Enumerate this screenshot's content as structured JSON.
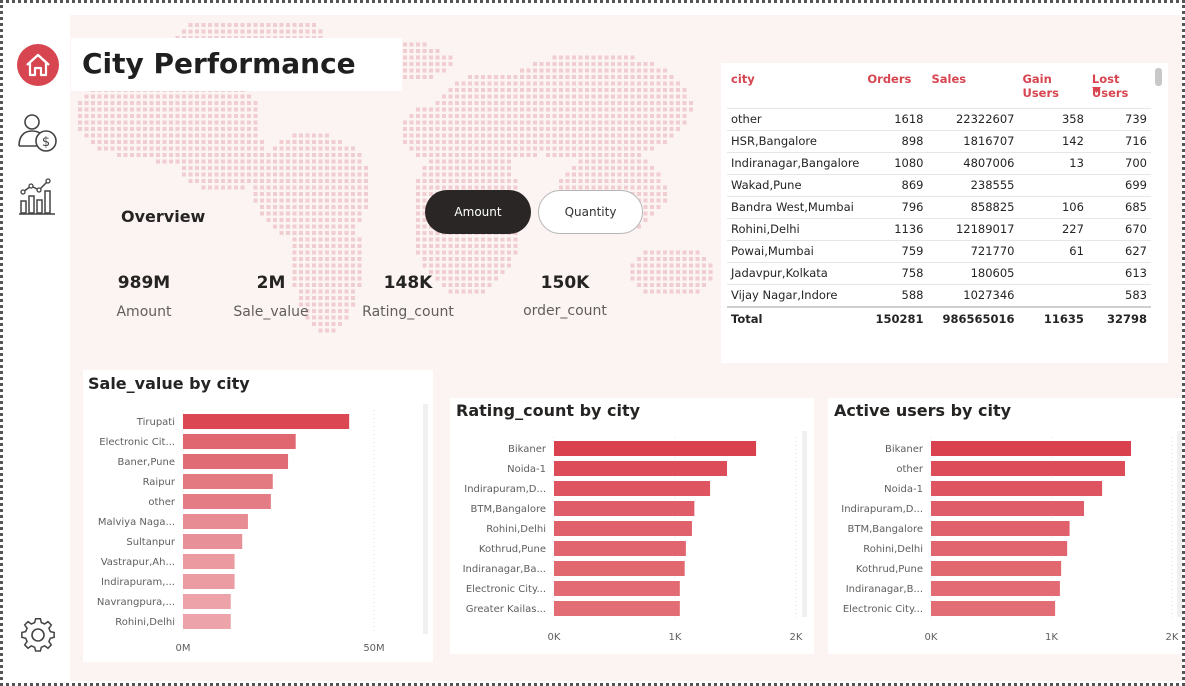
{
  "title": "City Performance",
  "overview_label": "Overview",
  "toggle": {
    "amount": "Amount",
    "quantity": "Quantity"
  },
  "kpis": [
    {
      "value": "989M",
      "label": "Amount"
    },
    {
      "value": "2M",
      "label": "Sale_value"
    },
    {
      "value": "148K",
      "label": "Rating_count"
    },
    {
      "value": "150K",
      "label": "order_count"
    }
  ],
  "table": {
    "headers": [
      "city",
      "Orders",
      "Sales",
      "Gain Users",
      "Lost Users"
    ],
    "rows": [
      [
        "other",
        "1618",
        "22322607",
        "358",
        "739"
      ],
      [
        "HSR,Bangalore",
        "898",
        "1816707",
        "142",
        "716"
      ],
      [
        "Indiranagar,Bangalore",
        "1080",
        "4807006",
        "13",
        "700"
      ],
      [
        "Wakad,Pune",
        "869",
        "238555",
        "",
        "699"
      ],
      [
        "Bandra West,Mumbai",
        "796",
        "858825",
        "106",
        "685"
      ],
      [
        "Rohini,Delhi",
        "1136",
        "12189017",
        "227",
        "670"
      ],
      [
        "Powai,Mumbai",
        "759",
        "721770",
        "61",
        "627"
      ],
      [
        "Jadavpur,Kolkata",
        "758",
        "180605",
        "",
        "613"
      ],
      [
        "Vijay Nagar,Indore",
        "588",
        "1027346",
        "",
        "583"
      ]
    ],
    "total": [
      "Total",
      "150281",
      "986565016",
      "11635",
      "32798"
    ]
  },
  "colors": {
    "accent": "#d64550",
    "dark_toggle": "#2b2626",
    "background": "#fcf3f3"
  },
  "icons": [
    "home-icon",
    "user-money-icon",
    "analytics-icon",
    "settings-icon"
  ],
  "chart_data": [
    {
      "type": "bar",
      "orientation": "horizontal",
      "title": "Sale_value by city",
      "categories": [
        "Tirupati",
        "Electronic Cit...",
        "Baner,Pune",
        "Raipur",
        "other",
        "Malviya Naga...",
        "Sultanpur",
        "Vastrapur,Ah...",
        "Indirapuram,...",
        "Navrangpura,...",
        "Rohini,Delhi"
      ],
      "values": [
        43500000,
        29500000,
        27500000,
        23500000,
        23000000,
        17000000,
        15500000,
        13500000,
        13500000,
        12500000,
        12500000
      ],
      "xlim": [
        0,
        50000000
      ],
      "xticks": [
        "0M",
        "50M"
      ]
    },
    {
      "type": "bar",
      "orientation": "horizontal",
      "title": "Rating_count by city",
      "categories": [
        "Bikaner",
        "Noida-1",
        "Indirapuram,D...",
        "BTM,Bangalore",
        "Rohini,Delhi",
        "Kothrud,Pune",
        "Indiranagar,Ba...",
        "Electronic City...",
        "Greater Kailas..."
      ],
      "values": [
        1670,
        1430,
        1290,
        1160,
        1140,
        1090,
        1080,
        1040,
        1040
      ],
      "xlim": [
        0,
        2000
      ],
      "xticks": [
        "0K",
        "1K",
        "2K"
      ]
    },
    {
      "type": "bar",
      "orientation": "horizontal",
      "title": "Active users by city",
      "categories": [
        "Bikaner",
        "other",
        "Noida-1",
        "Indirapuram,D...",
        "BTM,Bangalore",
        "Rohini,Delhi",
        "Kothrud,Pune",
        "Indiranagar,B...",
        "Electronic City..."
      ],
      "values": [
        1660,
        1610,
        1420,
        1270,
        1150,
        1130,
        1080,
        1070,
        1030
      ],
      "xlim": [
        0,
        2000
      ],
      "xticks": [
        "0K",
        "1K",
        "2K"
      ]
    }
  ]
}
